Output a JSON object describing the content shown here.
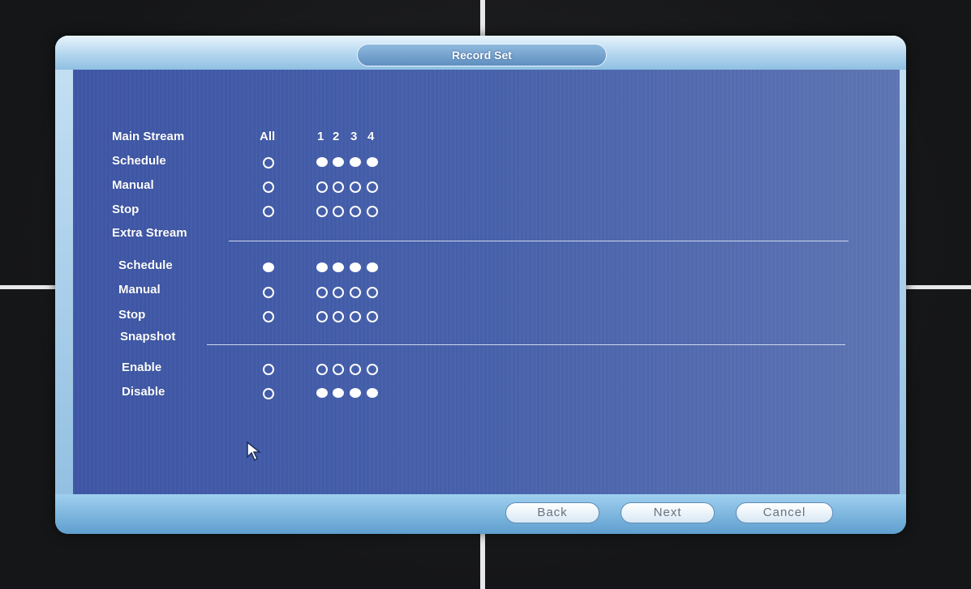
{
  "dialog": {
    "title": "Record Set"
  },
  "main_stream": {
    "header_label": "Main Stream",
    "all_label": "All",
    "channels": [
      "1",
      "2",
      "3",
      "4"
    ],
    "rows": [
      {
        "label": "Schedule",
        "all": false,
        "ch": [
          true,
          true,
          true,
          true
        ]
      },
      {
        "label": "Manual",
        "all": false,
        "ch": [
          false,
          false,
          false,
          false
        ]
      },
      {
        "label": "Stop",
        "all": false,
        "ch": [
          false,
          false,
          false,
          false
        ]
      }
    ]
  },
  "extra_stream": {
    "header_label": "Extra Stream",
    "rows": [
      {
        "label": "Schedule",
        "all": true,
        "ch": [
          true,
          true,
          true,
          true
        ]
      },
      {
        "label": "Manual",
        "all": false,
        "ch": [
          false,
          false,
          false,
          false
        ]
      },
      {
        "label": "Stop",
        "all": false,
        "ch": [
          false,
          false,
          false,
          false
        ]
      }
    ]
  },
  "snapshot": {
    "header_label": "Snapshot",
    "rows": [
      {
        "label": "Enable",
        "all": false,
        "ch": [
          false,
          false,
          false,
          false
        ]
      },
      {
        "label": "Disable",
        "all": false,
        "ch": [
          true,
          true,
          true,
          true
        ]
      }
    ]
  },
  "buttons": {
    "back": "Back",
    "next": "Next",
    "cancel": "Cancel"
  },
  "colors": {
    "panel": "#4660aa",
    "frame": "#a9d2ef",
    "text": "#ffffff"
  }
}
